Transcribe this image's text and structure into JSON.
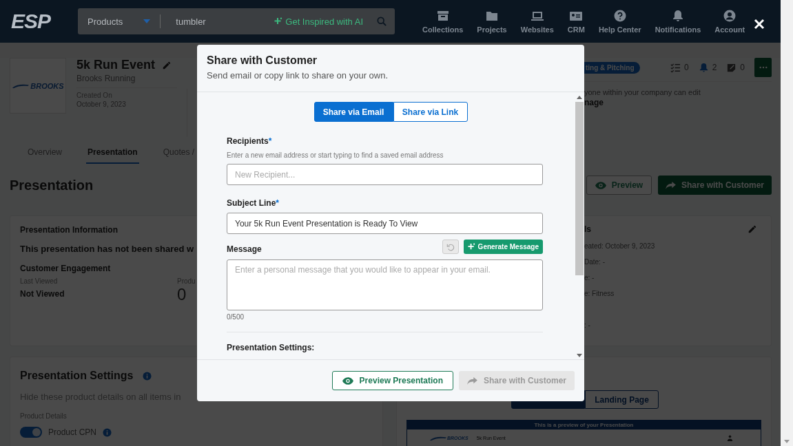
{
  "header": {
    "logo": "ESP",
    "search": {
      "category": "Products",
      "value": "tumbler",
      "ai_button": "Get Inspired with AI"
    },
    "nav": [
      {
        "kind": "collections",
        "label": "Collections"
      },
      {
        "kind": "projects",
        "label": "Projects"
      },
      {
        "kind": "websites",
        "label": "Websites"
      },
      {
        "kind": "crm",
        "label": "CRM"
      },
      {
        "kind": "help",
        "label": "Help Center"
      },
      {
        "kind": "notifications",
        "label": "Notifications"
      },
      {
        "kind": "account",
        "label": "Account"
      }
    ]
  },
  "project": {
    "logo": "BROOKS",
    "title": "5k Run Event",
    "client": "Brooks Running",
    "created_label": "Created On",
    "created_date": "October 9, 2023",
    "stage": "ting & Pitching",
    "counts": [
      {
        "kind": "tasks",
        "value": "0"
      },
      {
        "kind": "notifications",
        "value": "2"
      },
      {
        "kind": "notes",
        "value": "0"
      }
    ],
    "permission": "yone within your company can edit",
    "permission_value": "nage"
  },
  "tabs": [
    {
      "label": "Overview",
      "selected": false
    },
    {
      "label": "Presentation",
      "selected": true
    },
    {
      "label": "Quotes /",
      "selected": false
    }
  ],
  "page_title": "Presentation",
  "page_actions": [
    {
      "kind": "preview",
      "label": "Preview"
    },
    {
      "kind": "share",
      "label": "Share with Customer"
    }
  ],
  "info_card": {
    "title": "Presentation Information",
    "status": "This presentation has not been shared w",
    "engagement_title": "Customer Engagement",
    "last_viewed_label": "Last Viewed",
    "last_viewed_value": "Not Viewed",
    "products_label": "Produ",
    "products_value": "0"
  },
  "details_card": {
    "title": "ls",
    "lines": [
      "eated: October 9, 2023",
      "Date: -",
      "e: -",
      "e: Fitness",
      ": -"
    ]
  },
  "settings_card": {
    "title": "Presentation Settings",
    "description": "Hide these product details on all items in",
    "group": "Product Details",
    "toggles": [
      {
        "label": "Product CPN",
        "on": true
      }
    ]
  },
  "preview_card": {
    "tabs": [
      {
        "selected": true
      },
      {
        "label": "Landing Page",
        "selected": false
      }
    ],
    "banner": "This is a preview of your Presentation",
    "logo": "BROOKS",
    "title": "5k Run Event"
  },
  "modal": {
    "title": "Share with Customer",
    "subtitle": "Send email or copy link to share on your own.",
    "required_mark": "*",
    "modes": [
      {
        "label": "Share via Email",
        "selected": true
      },
      {
        "label": "Share via Link",
        "selected": false
      }
    ],
    "recipients": {
      "label": "Recipients",
      "required": true,
      "hint": "Enter a new email address or start typing to find a saved email address",
      "placeholder": "New Recipient..."
    },
    "subject": {
      "label": "Subject Line",
      "required": true,
      "value": "Your 5k Run Event Presentation is Ready To View"
    },
    "message": {
      "label": "Message",
      "generate_button": "Generate Message",
      "placeholder": "Enter a personal message that you would like to appear in your email.",
      "counter": "0/500"
    },
    "settings_label": "Presentation Settings:",
    "footer": [
      {
        "kind": "preview",
        "label": "Preview Presentation",
        "disabled": false
      },
      {
        "kind": "share",
        "label": "Share with Customer",
        "disabled": true
      }
    ]
  }
}
